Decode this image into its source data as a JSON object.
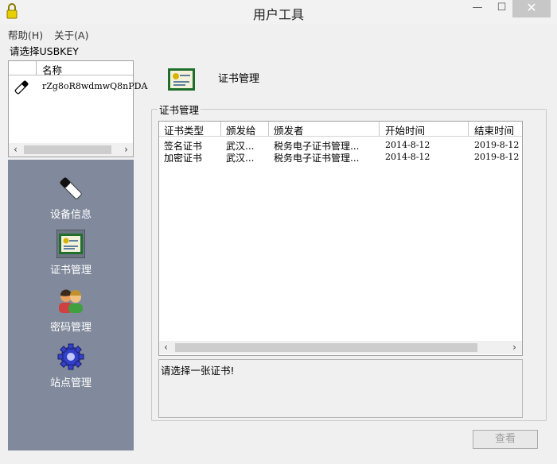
{
  "window": {
    "title": "用户工具",
    "minimize": "—",
    "maximize": "☐",
    "close": "✕"
  },
  "menu": [
    {
      "label": "帮助(H)"
    },
    {
      "label": "关于(A)"
    }
  ],
  "usbkey": {
    "prompt": "请选择USBKEY",
    "column_name": "名称",
    "items": [
      {
        "name": "rZg8oR8wdmwQ8nPDA"
      }
    ]
  },
  "nav": [
    {
      "label": "设备信息",
      "icon": "usbkey-icon"
    },
    {
      "label": "证书管理",
      "icon": "certificate-icon",
      "selected": true
    },
    {
      "label": "密码管理",
      "icon": "users-icon"
    },
    {
      "label": "站点管理",
      "icon": "gear-icon"
    }
  ],
  "main": {
    "header_title": "证书管理",
    "group_title": "证书管理",
    "columns": [
      "证书类型",
      "颁发给",
      "颁发者",
      "开始时间",
      "结束时间"
    ],
    "rows": [
      [
        "签名证书",
        "武汉...",
        "税务电子证书管理...",
        "2014-8-12",
        "2019-8-12"
      ],
      [
        "加密证书",
        "武汉...",
        "税务电子证书管理...",
        "2014-8-12",
        "2019-8-12"
      ]
    ],
    "status": "请选择一张证书!",
    "view_button": "查看"
  },
  "colors": {
    "nav_bg": "#808a9c",
    "window_bg": "#f0f0f0",
    "close_bg": "#c7c7c7"
  }
}
